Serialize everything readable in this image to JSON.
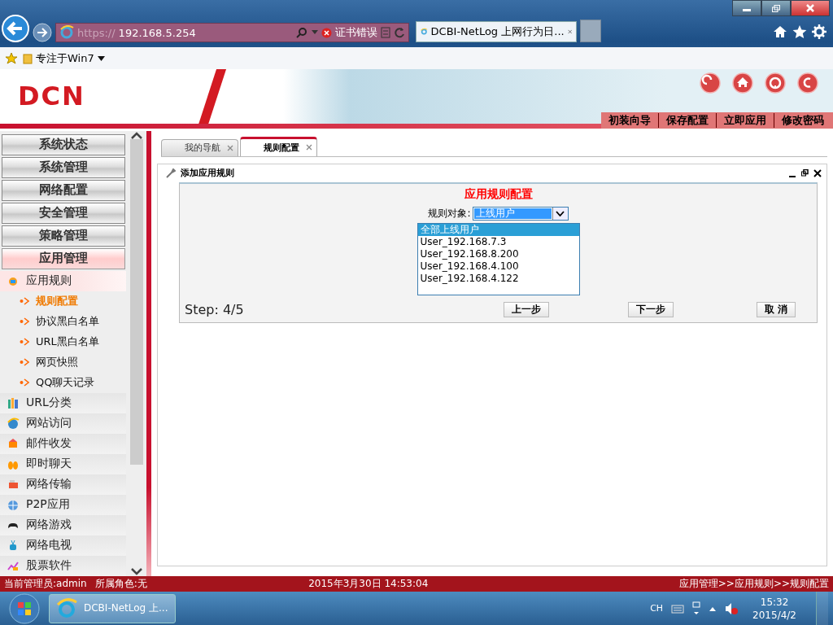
{
  "browser": {
    "address_scheme": "https://",
    "address_host": "192.168.5.254",
    "cert_error": "证书错误",
    "tab_title": "DCBI-NetLog 上网行为日...",
    "favorites": [
      "专注于Win7"
    ]
  },
  "header": {
    "logo": "DCN",
    "links": [
      "初装向导",
      "保存配置",
      "立即应用",
      "修改密码"
    ]
  },
  "sidebar": {
    "sections": [
      {
        "label": "系统状态",
        "selected": false
      },
      {
        "label": "系统管理",
        "selected": false
      },
      {
        "label": "网络配置",
        "selected": false
      },
      {
        "label": "安全管理",
        "selected": false
      },
      {
        "label": "策略管理",
        "selected": false
      },
      {
        "label": "应用管理",
        "selected": true
      }
    ],
    "items": [
      {
        "label": "应用规则",
        "expanded": true,
        "children": [
          {
            "label": "规则配置",
            "selected": true
          },
          {
            "label": "协议黑白名单",
            "selected": false
          },
          {
            "label": "URL黑白名单",
            "selected": false
          },
          {
            "label": "网页快照",
            "selected": false
          },
          {
            "label": "QQ聊天记录",
            "selected": false
          }
        ]
      },
      {
        "label": "URL分类",
        "expanded": false
      },
      {
        "label": "网站访问",
        "expanded": false
      },
      {
        "label": "邮件收发",
        "expanded": false
      },
      {
        "label": "即时聊天",
        "expanded": false
      },
      {
        "label": "网络传输",
        "expanded": false
      },
      {
        "label": "P2P应用",
        "expanded": false
      },
      {
        "label": "网络游戏",
        "expanded": false
      },
      {
        "label": "网络电视",
        "expanded": false
      },
      {
        "label": "股票软件",
        "expanded": false
      }
    ]
  },
  "tabs": [
    {
      "label": "我的导航",
      "selected": false
    },
    {
      "label": "规则配置",
      "selected": true
    }
  ],
  "panel": {
    "title": "添加应用规则"
  },
  "form": {
    "heading": "应用规则配置",
    "field_label": "规则对象:",
    "select_value": "上线用户",
    "options": [
      {
        "label": "全部上线用户",
        "selected": true
      },
      {
        "label": "User_192.168.7.3",
        "selected": false
      },
      {
        "label": "User_192.168.8.200",
        "selected": false
      },
      {
        "label": "User_192.168.4.100",
        "selected": false
      },
      {
        "label": "User_192.168.4.122",
        "selected": false
      }
    ],
    "step": "Step: 4/5",
    "buttons": [
      "上一步",
      "下一步",
      "取 消"
    ]
  },
  "status_bar": {
    "admin": "当前管理员:admin",
    "role": "所属角色:无",
    "datetime": "2015年3月30日 14:53:04",
    "breadcrumb": "应用管理>>应用规则>>规则配置"
  },
  "taskbar": {
    "task": "DCBI-NetLog 上...",
    "language": "CH",
    "time": "15:32",
    "date": "2015/4/2"
  }
}
